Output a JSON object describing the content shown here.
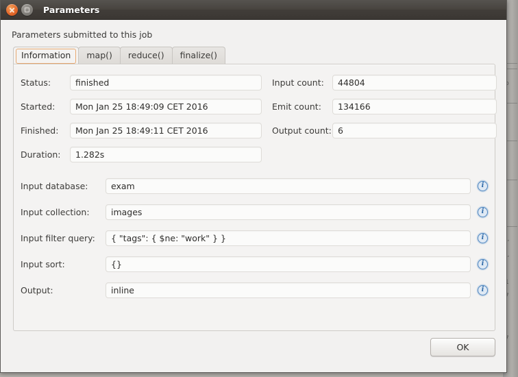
{
  "window": {
    "title": "Parameters",
    "close_icon": "close-icon",
    "maximize_icon": "maximize-icon"
  },
  "dialog": {
    "intro": "Parameters submitted to this job"
  },
  "tabs": [
    {
      "label": "Information",
      "active": true
    },
    {
      "label": "map()",
      "active": false
    },
    {
      "label": "reduce()",
      "active": false
    },
    {
      "label": "finalize()",
      "active": false
    }
  ],
  "information": {
    "left_column": [
      {
        "label": "Status:",
        "value": "finished"
      },
      {
        "label": "Started:",
        "value": "Mon Jan 25 18:49:09 CET 2016"
      },
      {
        "label": "Finished:",
        "value": "Mon Jan 25 18:49:11 CET 2016"
      },
      {
        "label": "Duration:",
        "value": "1.282s"
      }
    ],
    "right_column": [
      {
        "label": "Input count:",
        "value": "44804"
      },
      {
        "label": "Emit count:",
        "value": "134166"
      },
      {
        "label": "Output count:",
        "value": "6"
      }
    ],
    "full_rows": [
      {
        "label": "Input database:",
        "value": "exam",
        "info": "info-icon"
      },
      {
        "label": "Input collection:",
        "value": "images",
        "info": "info-icon"
      },
      {
        "label": "Input filter query:",
        "value": "{ \"tags\": { $ne: \"work\" } }",
        "info": "info-icon"
      },
      {
        "label": "Input sort:",
        "value": "{}",
        "info": "info-icon"
      },
      {
        "label": "Output:",
        "value": "inline",
        "info": "info-icon"
      }
    ]
  },
  "footer": {
    "ok_label": "OK"
  },
  "colors": {
    "titlebar": "#48443f",
    "close_button": "#e4682a",
    "dialog_background": "#f2f1f0",
    "panel_background": "#f4f3f2",
    "focus_ring": "#e8a971",
    "info_icon": "#4f86c0"
  }
}
